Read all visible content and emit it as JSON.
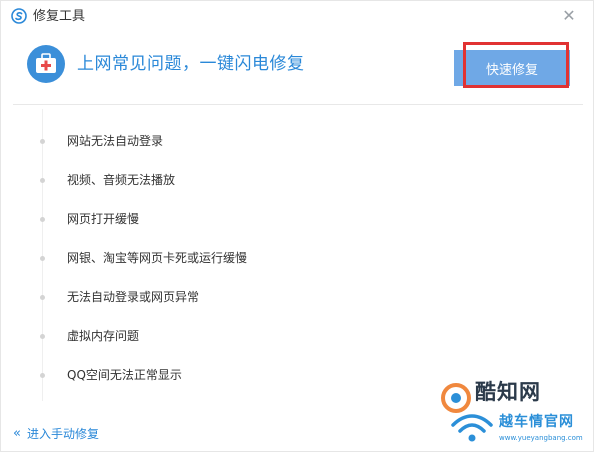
{
  "window": {
    "title": "修复工具",
    "close_icon": "close-icon",
    "app_icon": "browser-logo-icon"
  },
  "header": {
    "icon": "medical-kit-icon",
    "headline": "上网常见问题，一键闪电修复",
    "fix_button_label": "快速修复"
  },
  "issues": [
    {
      "label": "网站无法自动登录"
    },
    {
      "label": "视频、音频无法播放"
    },
    {
      "label": "网页打开缓慢"
    },
    {
      "label": "网银、淘宝等网页卡死或运行缓慢"
    },
    {
      "label": "无法自动登录或网页异常"
    },
    {
      "label": "虚拟内存问题"
    },
    {
      "label": "QQ空间无法正常显示"
    }
  ],
  "footer": {
    "manual_repair_label": "进入手动修复",
    "chevron_icon": "double-chevron-left-icon"
  },
  "watermark": {
    "brand_main": "酷知网",
    "brand_secondary": "越车情官网",
    "url": "www.yueyangbang.com"
  },
  "colors": {
    "accent_blue": "#2a88d8",
    "button_blue": "#6fa8e6",
    "highlight_red": "#e13232",
    "medical_icon_bg": "#3b8fd9"
  }
}
